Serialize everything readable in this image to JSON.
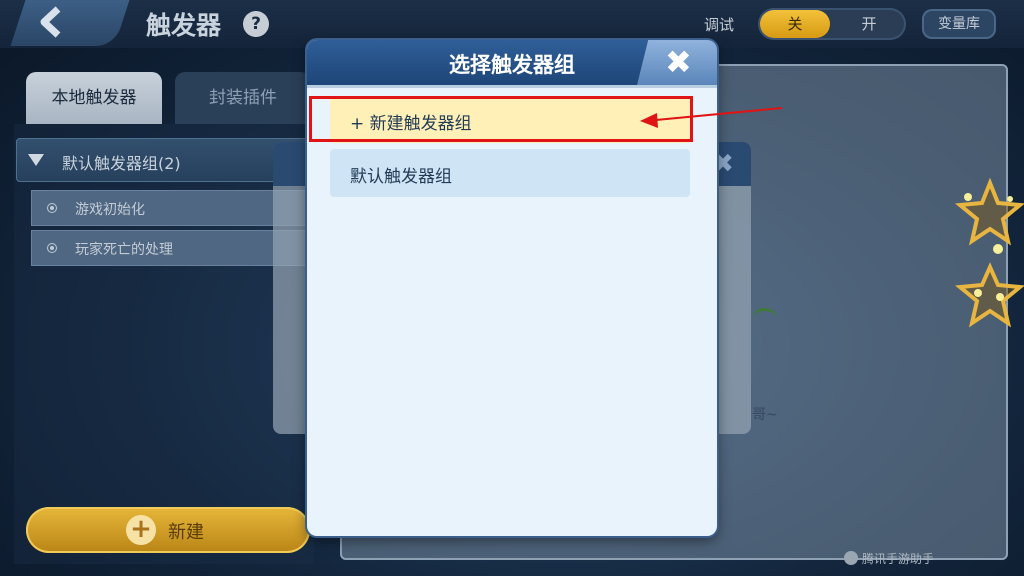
{
  "header": {
    "title": "触发器",
    "help_icon": "?",
    "debug_label": "调试",
    "toggle_off": "关",
    "toggle_on": "开",
    "var_library": "变量库"
  },
  "tabs": {
    "local": "本地触发器",
    "plugin": "封装插件"
  },
  "trigger_group": {
    "label": "默认触发器组(2)",
    "items": [
      "游戏初始化",
      "玩家死亡的处理"
    ]
  },
  "new_button": {
    "label": "新建"
  },
  "behind_dialog": {
    "text": "哥~"
  },
  "dialog": {
    "title": "选择触发器组",
    "options": [
      "+ 新建触发器组",
      "默认触发器组"
    ]
  },
  "colors": {
    "accent_yellow": "#e7b73a",
    "dialog_header": "#2f5e98",
    "annotation_red": "#e01414"
  },
  "watermark": "腾讯手游助手"
}
